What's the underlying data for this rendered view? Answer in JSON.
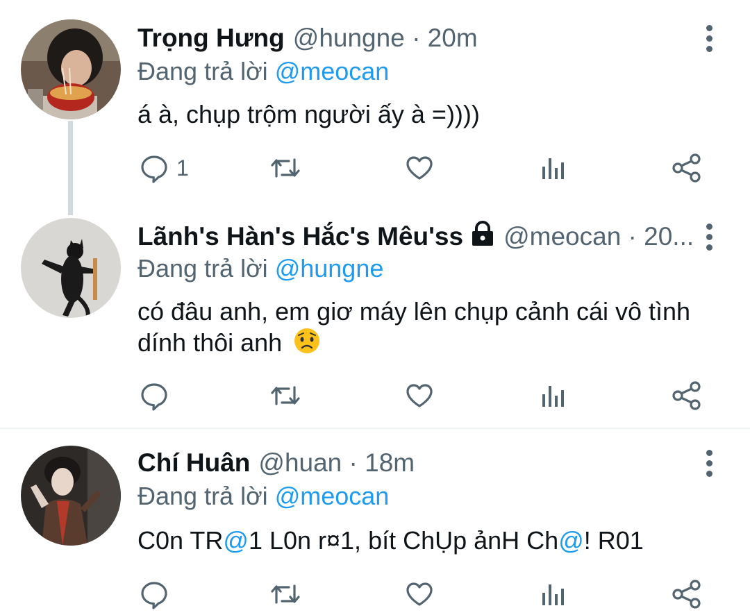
{
  "colors": {
    "accent": "#1d9bf0",
    "text": "#0f1419",
    "secondary": "#536471",
    "thread_line": "#cfd9de"
  },
  "tweets": [
    {
      "name": "Trọng Hưng",
      "handle": "@hungne · 20m",
      "reply_prefix": "Đang trả lời ",
      "reply_to": "@meocan",
      "text": "á à, chụp trộm người ấy à =))))",
      "reply_count": "1"
    },
    {
      "name": "Lãnh's Hàn's Hắc's Mêu'ss",
      "handle": "@meocan · 20...",
      "reply_prefix": "Đang trả lời ",
      "reply_to": "@hungne",
      "text": "có đâu anh, em giơ máy lên chụp cảnh cái vô tình dính thôi anh",
      "emoji": "worried-face",
      "reply_count": ""
    },
    {
      "name": "Chí Huân",
      "handle": "@huan · 18m",
      "reply_prefix": "Đang trả lời ",
      "reply_to": "@meocan",
      "text_parts": [
        "C0n TR",
        "@",
        "1 L0n r¤1, bít ChỤp ảnH Ch",
        "@",
        "! R01"
      ],
      "reply_count": ""
    }
  ],
  "icons": [
    "reply-icon",
    "retweet-icon",
    "like-icon",
    "analytics-icon",
    "share-icon",
    "more-icon",
    "lock-icon"
  ]
}
